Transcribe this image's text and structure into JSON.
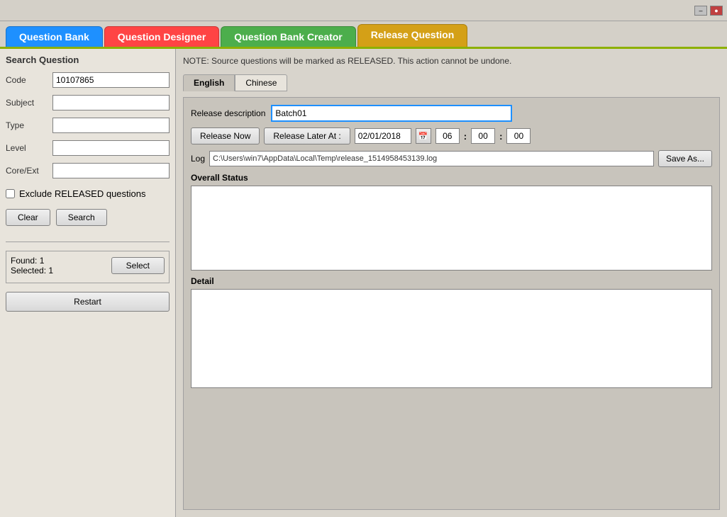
{
  "titleBar": {
    "minimizeLabel": "–",
    "closeLabel": "●"
  },
  "tabs": [
    {
      "id": "question-bank",
      "label": "Question Bank",
      "active": false
    },
    {
      "id": "question-designer",
      "label": "Question Designer",
      "active": false
    },
    {
      "id": "question-bank-creator",
      "label": "Question Bank Creator",
      "active": false
    },
    {
      "id": "release-question",
      "label": "Release Question",
      "active": true
    }
  ],
  "leftPanel": {
    "title": "Search Question",
    "fields": [
      {
        "id": "code",
        "label": "Code",
        "value": "10107865",
        "placeholder": ""
      },
      {
        "id": "subject",
        "label": "Subject",
        "value": "",
        "placeholder": ""
      },
      {
        "id": "type",
        "label": "Type",
        "value": "",
        "placeholder": ""
      },
      {
        "id": "level",
        "label": "Level",
        "value": "",
        "placeholder": ""
      },
      {
        "id": "core-ext",
        "label": "Core/Ext",
        "value": "",
        "placeholder": ""
      }
    ],
    "excludeLabel": "Exclude RELEASED questions",
    "clearButton": "Clear",
    "searchButton": "Search",
    "foundLabel": "Found: 1",
    "selectedLabel": "Selected: 1",
    "selectButton": "Select",
    "restartButton": "Restart"
  },
  "rightPanel": {
    "notice": "NOTE: Source questions will be marked as RELEASED. This action cannot be undone.",
    "langTabs": [
      {
        "id": "english",
        "label": "English",
        "active": true
      },
      {
        "id": "chinese",
        "label": "Chinese",
        "active": false
      }
    ],
    "releaseDescLabel": "Release description",
    "releaseDescValue": "Batch01",
    "releaseNowButton": "Release Now",
    "releaseLaterButton": "Release Later At :",
    "dateValue": "02/01/2018",
    "calendarIcon": "📅",
    "hour": "06",
    "minute1": "00",
    "minute2": "00",
    "logLabel": "Log",
    "logValue": "C:\\Users\\win7\\AppData\\Local\\Temp\\release_1514958453139.log",
    "saveAsButton": "Save As...",
    "overallStatusLabel": "Overall Status",
    "detailLabel": "Detail"
  }
}
